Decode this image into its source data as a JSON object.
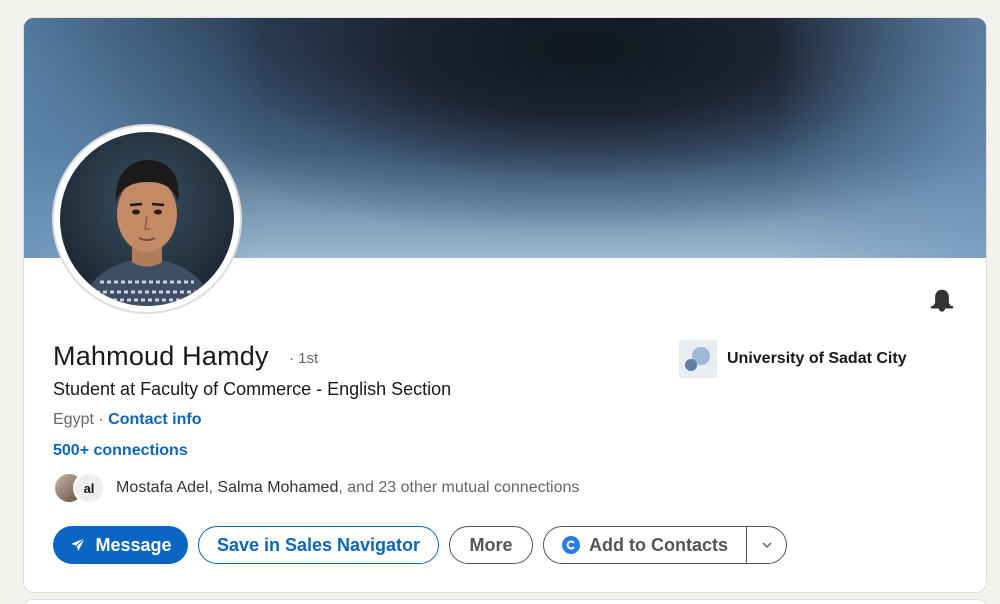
{
  "profile": {
    "name": "Mahmoud Hamdy",
    "degree": "· 1st",
    "headline": "Student at Faculty of Commerce - English Section",
    "location": "Egypt · ",
    "contact_info": "Contact info",
    "connections": "500+ connections",
    "mutual": {
      "names": [
        "Mostafa Adel",
        "Salma Mohamed"
      ],
      "separator": ", ",
      "suffix": ", and 23 other mutual connections",
      "avatar2_text": "al"
    }
  },
  "education": {
    "name": "University of Sadat City"
  },
  "actions": {
    "message": "Message",
    "save_sales_navigator": "Save in Sales Navigator",
    "more": "More",
    "add_to_contacts": "Add to Contacts"
  },
  "colors": {
    "accent": "#0a66c2",
    "muted": "#666666",
    "background": "#f3f2ef"
  },
  "icons": {
    "bell": "bell-icon",
    "message": "send-icon",
    "contacts": "google-contacts-icon",
    "dropdown": "chevron-down-icon"
  }
}
